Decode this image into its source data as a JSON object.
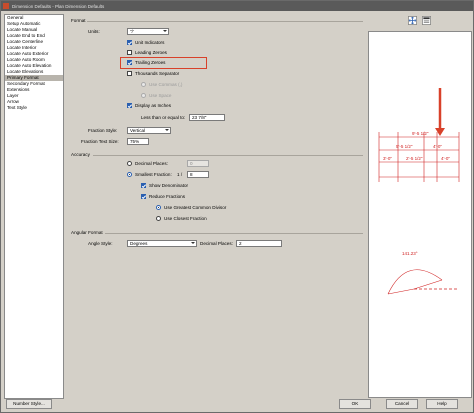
{
  "window": {
    "title": "Dimension Defaults - Plan Dimension Defaults"
  },
  "sidebar": {
    "items": [
      {
        "label": "General",
        "selected": false
      },
      {
        "label": "Setup Automatic",
        "selected": false
      },
      {
        "label": "Locate Manual",
        "selected": false
      },
      {
        "label": "Locate End to End",
        "selected": false
      },
      {
        "label": "Locate Centerline",
        "selected": false
      },
      {
        "label": "Locate Interior",
        "selected": false
      },
      {
        "label": "Locate Auto Exterior",
        "selected": false
      },
      {
        "label": "Locate Auto Room",
        "selected": false
      },
      {
        "label": "Locate Auto Elevation",
        "selected": false
      },
      {
        "label": "Locate Elevations",
        "selected": false
      },
      {
        "label": "Primary Format",
        "selected": true
      },
      {
        "label": "Secondary Format",
        "selected": false
      },
      {
        "label": "Extensions",
        "selected": false
      },
      {
        "label": "Layer",
        "selected": false
      },
      {
        "label": "Arrow",
        "selected": false
      },
      {
        "label": "Text Style",
        "selected": false
      }
    ]
  },
  "format": {
    "group_label": "Format",
    "units_label": "Units:",
    "units_value": "\"/'",
    "unit_indicators": "Unit Indicators",
    "leading_zeroes": "Leading Zeroes",
    "trailing_zeroes": "Trailing Zeroes",
    "thousands_separator": "Thousands Separator",
    "use_commas": "Use Commas (,)",
    "use_space": "Use Space",
    "display_as_inches": "Display as Inches",
    "less_than_label": "Less than or equal to:",
    "less_than_value": "23 7/8\"",
    "fraction_style_label": "Fraction Style:",
    "fraction_style_value": "Vertical",
    "fraction_text_size_label": "Fraction Text Size:",
    "fraction_text_size_value": "75%"
  },
  "accuracy": {
    "group_label": "Accuracy",
    "decimal_places": "Decimal Places:",
    "decimal_places_value": "0",
    "smallest_fraction": "Smallest Fraction:",
    "smallest_fraction_prefix": "1 /",
    "smallest_fraction_value": "8",
    "show_denominator": "Show Denominator",
    "reduce_fractions": "Reduce Fractions",
    "use_gcd": "Use Greatest Common Divisor",
    "use_closest": "Use Closest Fraction"
  },
  "angular": {
    "group_label": "Angular Format",
    "angle_style_label": "Angle Style:",
    "angle_style_value": "Degrees",
    "decimal_places_label": "Decimal Places:",
    "decimal_places_value": "2"
  },
  "preview": {
    "dims": {
      "top": "9'-5 1/2\"",
      "mid_left": "5'-5 1/2\"",
      "mid_right": "4'-0\"",
      "bottom_left": "3'-0\"",
      "bottom_mid": "2'-5 1/2\"",
      "bottom_right": "4'-0\""
    },
    "angle": "141.23°"
  },
  "buttons": {
    "number_style": "Number Style...",
    "ok": "OK",
    "cancel": "Cancel",
    "help": "Help"
  },
  "colors": {
    "accent": "#2a5fb0",
    "highlight": "#d8412a",
    "dimension_red": "#d02020"
  }
}
